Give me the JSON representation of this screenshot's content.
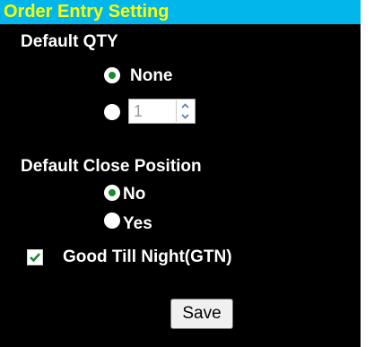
{
  "header": {
    "title": "Order Entry Setting"
  },
  "default_qty": {
    "label": "Default QTY",
    "options": [
      {
        "label": "None",
        "selected": true
      },
      {
        "label": "",
        "selected": false
      }
    ],
    "quantity": {
      "value": "1",
      "enabled": false
    }
  },
  "default_close_position": {
    "label": "Default Close Position",
    "options": [
      {
        "label": "No",
        "selected": true
      },
      {
        "label": "Yes",
        "selected": false
      }
    ]
  },
  "gtn": {
    "label": "Good Till Night(GTN)",
    "checked": true
  },
  "save_label": "Save",
  "colors": {
    "header_bg": "#00b6ea",
    "header_text": "#ffff00",
    "panel_bg": "#000000",
    "radio_dot": "#1e8a2e",
    "checkmark": "#1e8a2e"
  }
}
